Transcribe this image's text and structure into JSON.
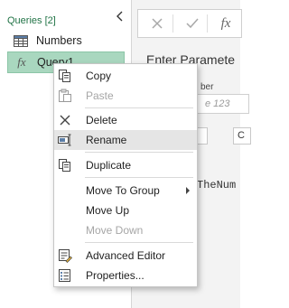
{
  "queries_pane": {
    "header": "Queries [2]",
    "items": [
      {
        "label": "Numbers",
        "icon": "table-icon"
      },
      {
        "label": "Query1",
        "icon": "fx-icon"
      }
    ]
  },
  "formula_bar": {
    "cancel_icon": "close-icon",
    "commit_icon": "check-icon",
    "fx_label": "fx"
  },
  "parameters": {
    "title": "Enter Paramete",
    "label": "ber",
    "placeholder": "e 123",
    "button_2": "C"
  },
  "result_text": "TheNum",
  "context_menu": {
    "items": {
      "copy": "Copy",
      "paste": "Paste",
      "delete": "Delete",
      "rename": "Rename",
      "duplicate": "Duplicate",
      "move_to_group": "Move To Group",
      "move_up": "Move Up",
      "move_down": "Move Down",
      "advanced_editor": "Advanced Editor",
      "properties": "Properties..."
    }
  },
  "colors": {
    "accent_green": "#217346",
    "selected_item": "#a9d7bf",
    "menu_highlight": "#e5e5e5"
  }
}
